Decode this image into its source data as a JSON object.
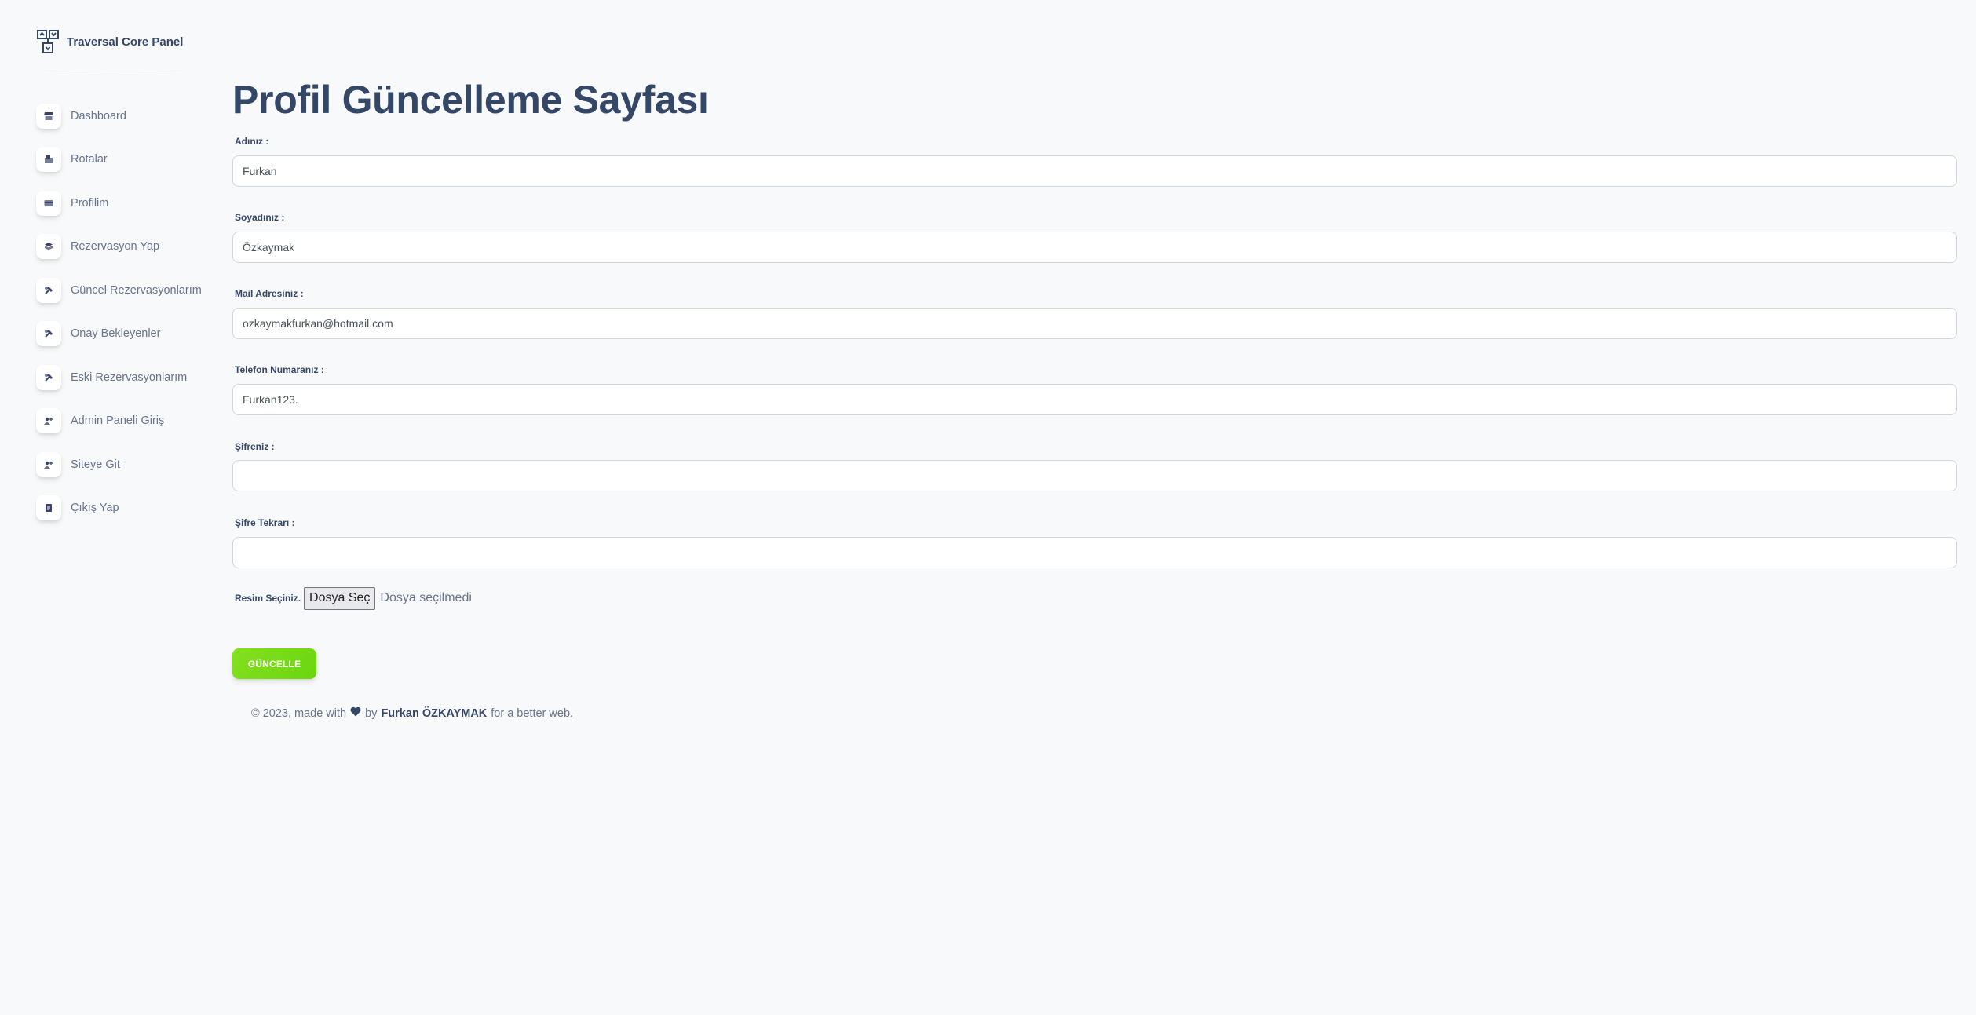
{
  "brand": {
    "name": "Traversal Core Panel",
    "logo_icon": "dashboard-layout-logo-icon"
  },
  "sidebar": {
    "items": [
      {
        "label": "Dashboard",
        "icon": "shop-icon"
      },
      {
        "label": "Rotalar",
        "icon": "office-icon"
      },
      {
        "label": "Profilim",
        "icon": "credit-card-icon"
      },
      {
        "label": "Rezervasyon Yap",
        "icon": "box-icon"
      },
      {
        "label": "Güncel Rezervasyonlarım",
        "icon": "tools-icon"
      },
      {
        "label": "Onay Bekleyenler",
        "icon": "tools-icon"
      },
      {
        "label": "Eski Rezervasyonlarım",
        "icon": "tools-icon"
      },
      {
        "label": "Admin Paneli Giriş",
        "icon": "user-plus-icon"
      },
      {
        "label": "Siteye Git",
        "icon": "user-plus-icon"
      },
      {
        "label": "Çıkış Yap",
        "icon": "document-icon"
      }
    ]
  },
  "page": {
    "title": "Profil Güncelleme Sayfası"
  },
  "form": {
    "name": {
      "label": "Adınız :",
      "value": "Furkan"
    },
    "surname": {
      "label": "Soyadınız :",
      "value": "Özkaymak"
    },
    "email": {
      "label": "Mail Adresiniz :",
      "value": "ozkaymakfurkan@hotmail.com"
    },
    "phone": {
      "label": "Telefon Numaranız :",
      "value": "Furkan123."
    },
    "password": {
      "label": "Şifreniz :",
      "value": ""
    },
    "password_repeat": {
      "label": "Şifre Tekrarı :",
      "value": ""
    },
    "image": {
      "label": "Resim Seçiniz.",
      "button_label": "Dosya Seç",
      "status": "Dosya seçilmedi"
    },
    "submit_label": "GÜNCELLE"
  },
  "footer": {
    "prefix": "© 2023, made with",
    "icon": "heart-icon",
    "by": "by",
    "author": "Furkan ÖZKAYMAK",
    "suffix": "for a better web."
  },
  "colors": {
    "background": "#f8f9fa",
    "text_dark": "#344767",
    "text_muted": "#67748e",
    "submit_gradient_start": "#6ad60f",
    "submit_gradient_end": "#84e01e"
  }
}
